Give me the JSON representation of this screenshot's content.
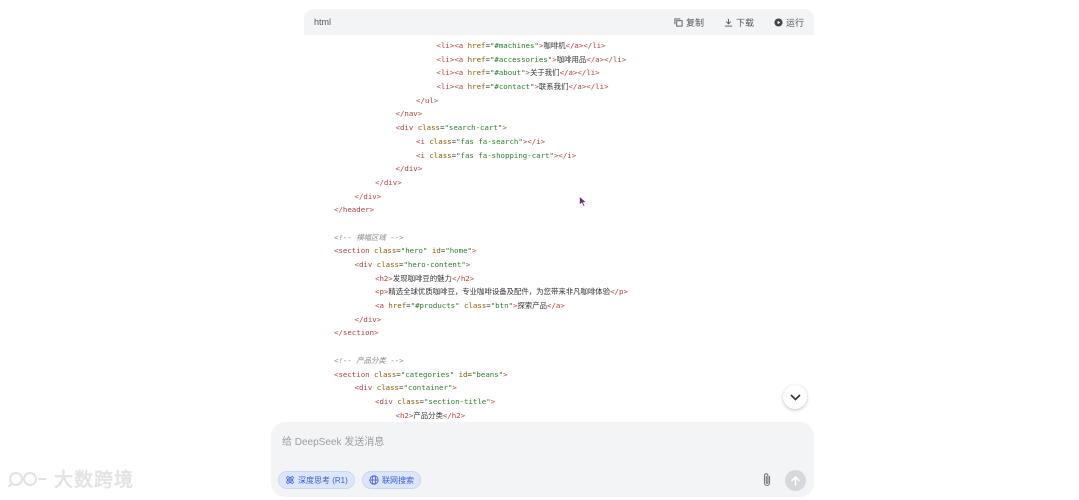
{
  "code_header": {
    "language": "html",
    "copy_label": "复制",
    "download_label": "下载",
    "run_label": "运行"
  },
  "code_lines": [
    [
      {
        "t": "t",
        "v": "<li>"
      },
      {
        "t": "t",
        "v": "<a "
      },
      {
        "t": "a",
        "v": "href"
      },
      {
        "t": "p",
        "v": "="
      },
      {
        "t": "s",
        "v": "\"#machines\""
      },
      {
        "t": "t",
        "v": ">"
      },
      {
        "t": "p",
        "v": "咖啡机"
      },
      {
        "t": "t",
        "v": "</a></li>"
      }
    ],
    [
      {
        "t": "t",
        "v": "<li>"
      },
      {
        "t": "t",
        "v": "<a "
      },
      {
        "t": "a",
        "v": "href"
      },
      {
        "t": "p",
        "v": "="
      },
      {
        "t": "s",
        "v": "\"#accessories\""
      },
      {
        "t": "t",
        "v": ">"
      },
      {
        "t": "p",
        "v": "咖啡用品"
      },
      {
        "t": "t",
        "v": "</a></li>"
      }
    ],
    [
      {
        "t": "t",
        "v": "<li>"
      },
      {
        "t": "t",
        "v": "<a "
      },
      {
        "t": "a",
        "v": "href"
      },
      {
        "t": "p",
        "v": "="
      },
      {
        "t": "s",
        "v": "\"#about\""
      },
      {
        "t": "t",
        "v": ">"
      },
      {
        "t": "p",
        "v": "关于我们"
      },
      {
        "t": "t",
        "v": "</a></li>"
      }
    ],
    [
      {
        "t": "t",
        "v": "<li>"
      },
      {
        "t": "t",
        "v": "<a "
      },
      {
        "t": "a",
        "v": "href"
      },
      {
        "t": "p",
        "v": "="
      },
      {
        "t": "s",
        "v": "\"#contact\""
      },
      {
        "t": "t",
        "v": ">"
      },
      {
        "t": "p",
        "v": "联系我们"
      },
      {
        "t": "t",
        "v": "</a></li>"
      }
    ],
    [
      {
        "t": "t",
        "v": "</ul>"
      }
    ],
    [
      {
        "t": "t",
        "v": "</nav>"
      }
    ],
    [
      {
        "t": "t",
        "v": "<div "
      },
      {
        "t": "a",
        "v": "class"
      },
      {
        "t": "p",
        "v": "="
      },
      {
        "t": "s",
        "v": "\"search-cart\""
      },
      {
        "t": "t",
        "v": ">"
      }
    ],
    [
      {
        "t": "t",
        "v": "<i "
      },
      {
        "t": "a",
        "v": "class"
      },
      {
        "t": "p",
        "v": "="
      },
      {
        "t": "s",
        "v": "\"fas fa-search\""
      },
      {
        "t": "t",
        "v": "></i>"
      }
    ],
    [
      {
        "t": "t",
        "v": "<i "
      },
      {
        "t": "a",
        "v": "class"
      },
      {
        "t": "p",
        "v": "="
      },
      {
        "t": "s",
        "v": "\"fas fa-shopping-cart\""
      },
      {
        "t": "t",
        "v": "></i>"
      }
    ],
    [
      {
        "t": "t",
        "v": "</div>"
      }
    ],
    [
      {
        "t": "t",
        "v": "</div>"
      }
    ],
    [
      {
        "t": "t",
        "v": "</div>"
      }
    ],
    [
      {
        "t": "t",
        "v": "</header>"
      }
    ],
    [],
    [
      {
        "t": "c",
        "v": "<!-- 横幅区域 -->"
      }
    ],
    [
      {
        "t": "t",
        "v": "<section "
      },
      {
        "t": "a",
        "v": "class"
      },
      {
        "t": "p",
        "v": "="
      },
      {
        "t": "s",
        "v": "\"hero\""
      },
      {
        "t": "p",
        "v": " "
      },
      {
        "t": "a",
        "v": "id"
      },
      {
        "t": "p",
        "v": "="
      },
      {
        "t": "s",
        "v": "\"home\""
      },
      {
        "t": "t",
        "v": ">"
      }
    ],
    [
      {
        "t": "t",
        "v": "<div "
      },
      {
        "t": "a",
        "v": "class"
      },
      {
        "t": "p",
        "v": "="
      },
      {
        "t": "s",
        "v": "\"hero-content\""
      },
      {
        "t": "t",
        "v": ">"
      }
    ],
    [
      {
        "t": "t",
        "v": "<h2>"
      },
      {
        "t": "p",
        "v": "发现咖啡豆的魅力"
      },
      {
        "t": "t",
        "v": "</h2>"
      }
    ],
    [
      {
        "t": "t",
        "v": "<p>"
      },
      {
        "t": "p",
        "v": "精选全球优质咖啡豆，专业咖啡设备及配件，为您带来非凡咖啡体验"
      },
      {
        "t": "t",
        "v": "</p>"
      }
    ],
    [
      {
        "t": "t",
        "v": "<a "
      },
      {
        "t": "a",
        "v": "href"
      },
      {
        "t": "p",
        "v": "="
      },
      {
        "t": "s",
        "v": "\"#products\""
      },
      {
        "t": "p",
        "v": " "
      },
      {
        "t": "a",
        "v": "class"
      },
      {
        "t": "p",
        "v": "="
      },
      {
        "t": "s",
        "v": "\"btn\""
      },
      {
        "t": "t",
        "v": ">"
      },
      {
        "t": "p",
        "v": "探索产品"
      },
      {
        "t": "t",
        "v": "</a>"
      }
    ],
    [
      {
        "t": "t",
        "v": "</div>"
      }
    ],
    [
      {
        "t": "t",
        "v": "</section>"
      }
    ],
    [],
    [
      {
        "t": "c",
        "v": "<!-- 产品分类 -->"
      }
    ],
    [
      {
        "t": "t",
        "v": "<section "
      },
      {
        "t": "a",
        "v": "class"
      },
      {
        "t": "p",
        "v": "="
      },
      {
        "t": "s",
        "v": "\"categories\""
      },
      {
        "t": "p",
        "v": " "
      },
      {
        "t": "a",
        "v": "id"
      },
      {
        "t": "p",
        "v": "="
      },
      {
        "t": "s",
        "v": "\"beans\""
      },
      {
        "t": "t",
        "v": ">"
      }
    ],
    [
      {
        "t": "t",
        "v": "<div "
      },
      {
        "t": "a",
        "v": "class"
      },
      {
        "t": "p",
        "v": "="
      },
      {
        "t": "s",
        "v": "\"container\""
      },
      {
        "t": "t",
        "v": ">"
      }
    ],
    [
      {
        "t": "t",
        "v": "<div "
      },
      {
        "t": "a",
        "v": "class"
      },
      {
        "t": "p",
        "v": "="
      },
      {
        "t": "s",
        "v": "\"section-title\""
      },
      {
        "t": "t",
        "v": ">"
      }
    ],
    [
      {
        "t": "t",
        "v": "<h2>"
      },
      {
        "t": "p",
        "v": "产品分类"
      },
      {
        "t": "t",
        "v": "</h2>"
      }
    ]
  ],
  "chat_input": {
    "placeholder": "给 DeepSeek 发送消息",
    "deep_think_label": "深度思考 (R1)",
    "web_search_label": "联网搜索"
  },
  "watermark": "大数跨境",
  "colors": {
    "chip_bg": "#dbe6fd",
    "chip_text": "#3b5bd6",
    "input_bg": "#f3f4f6"
  }
}
